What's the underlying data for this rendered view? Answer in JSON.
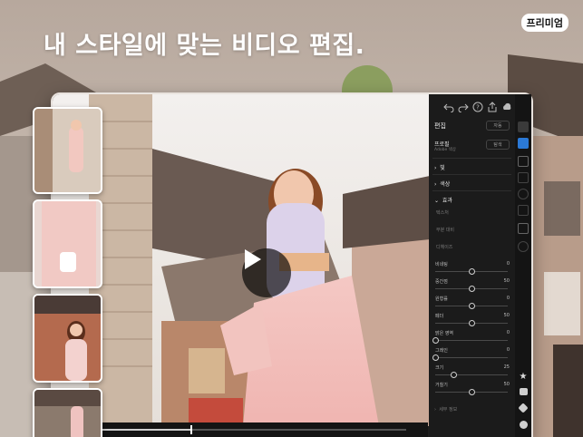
{
  "marketing": {
    "headline": "내 스타일에 맞는 비디오 편집.",
    "badge": "프리미엄"
  },
  "toolbar": {
    "icons": [
      "undo-icon",
      "redo-icon",
      "help-icon",
      "share-icon",
      "cloud-icon",
      "more-icon"
    ]
  },
  "panel": {
    "title": "편집",
    "auto_button": "자동",
    "profile_label": "프로필",
    "profile_sub": "Adobe 색상",
    "browse_button": "탐색",
    "sections": {
      "light": "빛",
      "color": "색상",
      "effects": "효과"
    },
    "effect_modes": [
      "텍스처",
      "부분 대비",
      "디헤이즈"
    ],
    "sliders": [
      {
        "label": "비네팅",
        "value": "0",
        "position": 0.5
      },
      {
        "label": "중간점",
        "value": "50",
        "position": 0.5
      },
      {
        "label": "원형률",
        "value": "0",
        "position": 0.5
      },
      {
        "label": "페더",
        "value": "50",
        "position": 0.5
      },
      {
        "label": "밝은 영역",
        "value": "0",
        "position": 0.0
      },
      {
        "label": "그레인",
        "value": "0",
        "position": 0.0
      },
      {
        "label": "크기",
        "value": "25",
        "position": 0.25
      },
      {
        "label": "거칠기",
        "value": "50",
        "position": 0.5
      }
    ],
    "detail_label": "세부 정보"
  },
  "timeline": {
    "progress": 0.36
  },
  "colors": {
    "accent": "#2b79d6",
    "panel_bg": "#1b1b1b"
  }
}
